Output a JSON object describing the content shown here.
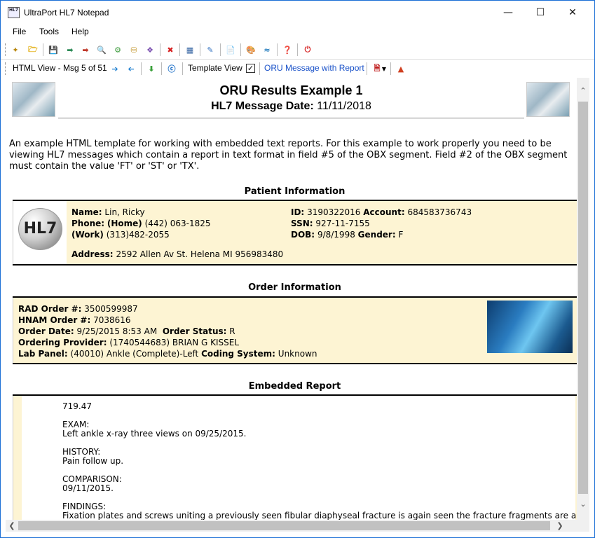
{
  "window": {
    "title": "UltraPort HL7 Notepad",
    "icon_text": "HL7"
  },
  "menu": [
    "File",
    "Tools",
    "Help"
  ],
  "toolbar2": {
    "view_label": "HTML View - Msg 5 of 51",
    "template_label": "Template View",
    "template_checked": "✓",
    "template_name": "ORU Message with Report",
    "link_color": "#1a52c9"
  },
  "header": {
    "title": "ORU Results Example 1",
    "date_label": "HL7 Message Date:",
    "date_value": "11/11/2018"
  },
  "intro": "An example HTML template for working with embedded text reports. For this example to work properly you need to be viewing HL7 messages which contain a report in text format in field #5 of the OBX segment. Field #2 of the OBX segment must contain the value 'FT' or 'ST' or 'TX'.",
  "patient": {
    "section_title": "Patient Information",
    "logo_text": "HL7",
    "name_label": "Name:",
    "name": "Lin, Ricky",
    "phone_label": "Phone:",
    "home_label": "(Home)",
    "home_phone": "(442) 063-1825",
    "work_label": "(Work)",
    "work_phone": "(313)482-2055",
    "address_label": "Address:",
    "address": "2592 Allen Av St. Helena MI 956983480",
    "id_label": "ID:",
    "id": "3190322016",
    "account_label": "Account:",
    "account": "684583736743",
    "ssn_label": "SSN:",
    "ssn": "927-11-7155",
    "dob_label": "DOB:",
    "dob": "9/8/1998",
    "gender_label": "Gender:",
    "gender": "F"
  },
  "order": {
    "section_title": "Order Information",
    "rad_label": "RAD Order #:",
    "rad": "3500599987",
    "hnam_label": "HNAM Order #:",
    "hnam": "7038616",
    "date_label": "Order Date:",
    "date": "9/25/2015 8:53 AM",
    "status_label": "Order Status:",
    "status": "R",
    "provider_label": "Ordering Provider:",
    "provider": "(1740544683) BRIAN G KISSEL",
    "panel_label": "Lab Panel:",
    "panel": "(40010) Ankle (Complete)-Left",
    "coding_label": "Coding System:",
    "coding": "Unknown"
  },
  "report": {
    "section_title": "Embedded Report",
    "text": "719.47\n\nEXAM:\nLeft ankle x-ray three views on 09/25/2015.\n\nHISTORY:\nPain follow up.\n\nCOMPARISON:\n09/11/2015.\n\nFINDINGS:\nFixation plates and screws uniting a previously seen fibular diaphyseal fracture is again seen the fracture fragments are aligned and"
  },
  "colors": {
    "info_bg": "#fdf4d3",
    "window_border": "#1a6fd6"
  }
}
